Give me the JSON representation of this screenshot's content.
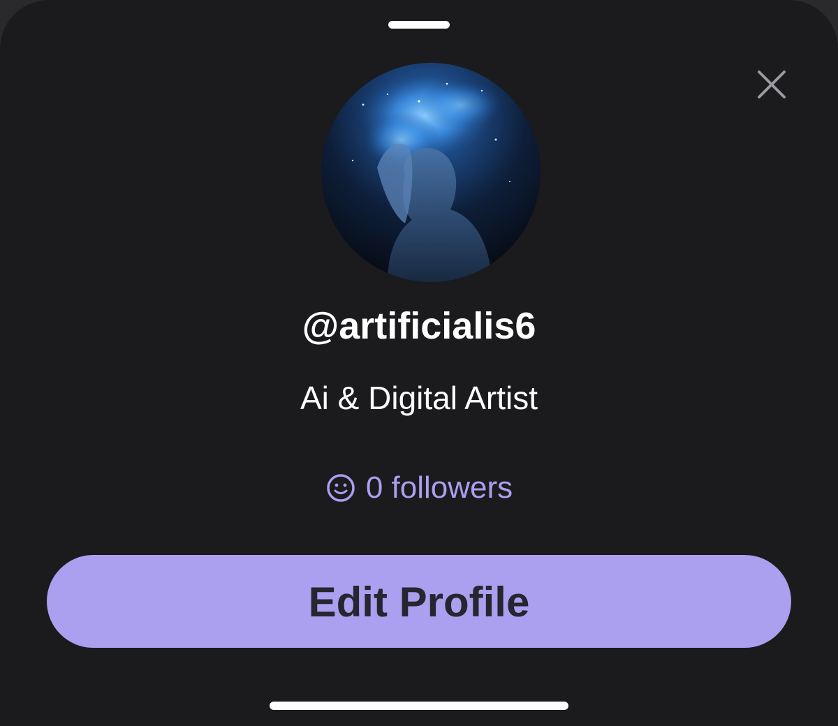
{
  "profile": {
    "username": "@artificialis6",
    "bio": "Ai & Digital Artist",
    "followers_label": "0 followers",
    "followers_count": 0
  },
  "actions": {
    "edit_profile_label": "Edit Profile"
  },
  "icons": {
    "close": "close-icon",
    "followers": "smiley-icon"
  },
  "colors": {
    "sheet_background": "#1b1b1d",
    "accent": "#ab9ff0",
    "followers_text": "#ad9ef0",
    "button_text": "#262630",
    "primary_text": "#ffffff"
  }
}
